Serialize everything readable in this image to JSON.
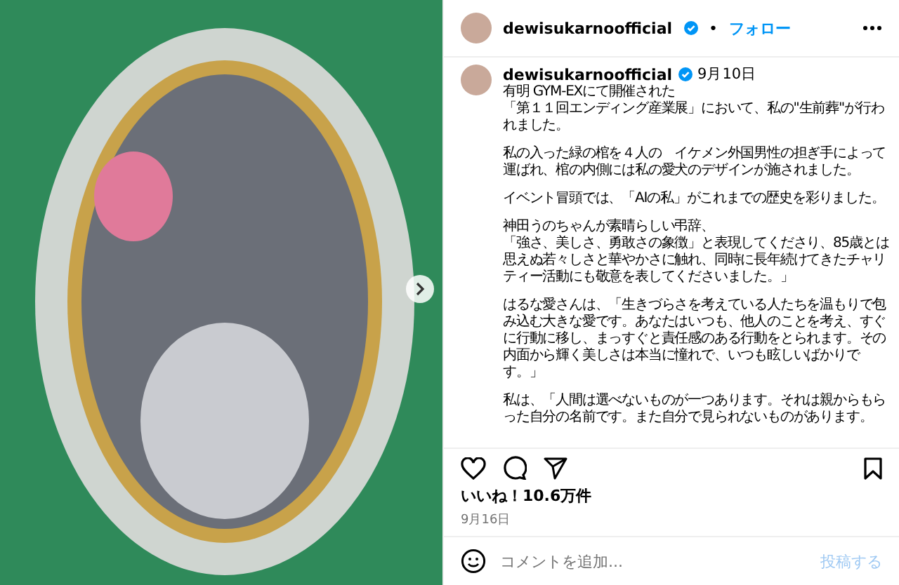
{
  "post": {
    "username": "dewisukarnoofficial",
    "verified": true,
    "separator": "•",
    "follow": "フォロー"
  },
  "caption": {
    "username": "dewisukarnoofficial",
    "verified": true,
    "date": "9月10日",
    "paragraphs": [
      {
        "lines": [
          "有明 GYM-EXにて開催された",
          "「第１１回エンディング産業展」において、私の\"生前葬\"が行われました。"
        ]
      },
      {
        "lines": [
          "私の入った緑の棺を４人の　イケメン外国男性の担ぎ手によって運ばれ、棺の内側には私の愛犬のデザインが施されました。"
        ]
      },
      {
        "lines": [
          "イベント冒頭では、「AIの私」がこれまでの歴史を彩りました。"
        ]
      },
      {
        "lines": [
          "神田うのちゃんが素晴らしい弔辞、",
          "「強さ、美しさ、勇敢さの象徴」と表現してくださり、85歳とは思えぬ若々しさと華やかさに触れ、同時に長年続けてきたチャリティー活動にも敬意を表してくださいました。」"
        ]
      },
      {
        "lines": [
          "はるな愛さんは、「生きづらさを考えている人たちを温もりで包み込む大きな愛です。あなたはいつも、他人のことを考え、すぐに行動に移し、まっすぐと責任感のある行動をとられます。その内面から輝く美しさは本当に憧れで、いつも眩しいばかりです。」"
        ]
      },
      {
        "lines": [
          "私は、「人間は選べないものが一つあります。それは親からもらった自分の名前です。また自分で見られないものがあります。"
        ]
      }
    ]
  },
  "likes": "いいね！10.6万件",
  "post_date": "9月16日",
  "comment": {
    "placeholder": "コメントを追加...",
    "submit": "投稿する"
  }
}
